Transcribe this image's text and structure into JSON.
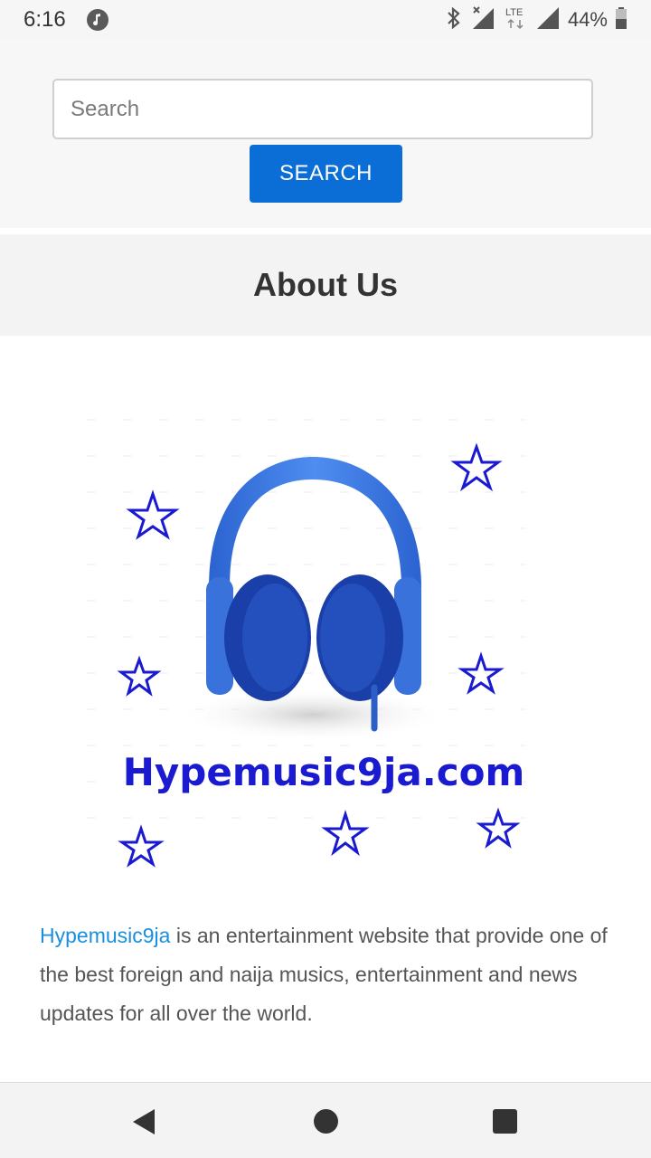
{
  "status_bar": {
    "time": "6:16",
    "battery": "44%",
    "network": "LTE",
    "icons": [
      "music-note-icon",
      "bluetooth-icon",
      "signal-icon",
      "lte-icon",
      "battery-icon"
    ]
  },
  "search": {
    "placeholder": "Search",
    "value": "",
    "button_label": "SEARCH"
  },
  "about": {
    "title": "About Us",
    "logo_text": "Hypemusic9ja.com",
    "link_text": "Hypemusic9ja",
    "body": " is an entertainment website that provide one of the best foreign and naija musics, entertainment and news updates for all over the world."
  },
  "colors": {
    "accent": "#0a6ed6",
    "link": "#1a8fe0",
    "logo_blue": "#1a1ad0",
    "headphone_blue": "#2f6fd6"
  },
  "nav": {
    "icons": [
      "back-icon",
      "home-icon",
      "recents-icon"
    ]
  }
}
